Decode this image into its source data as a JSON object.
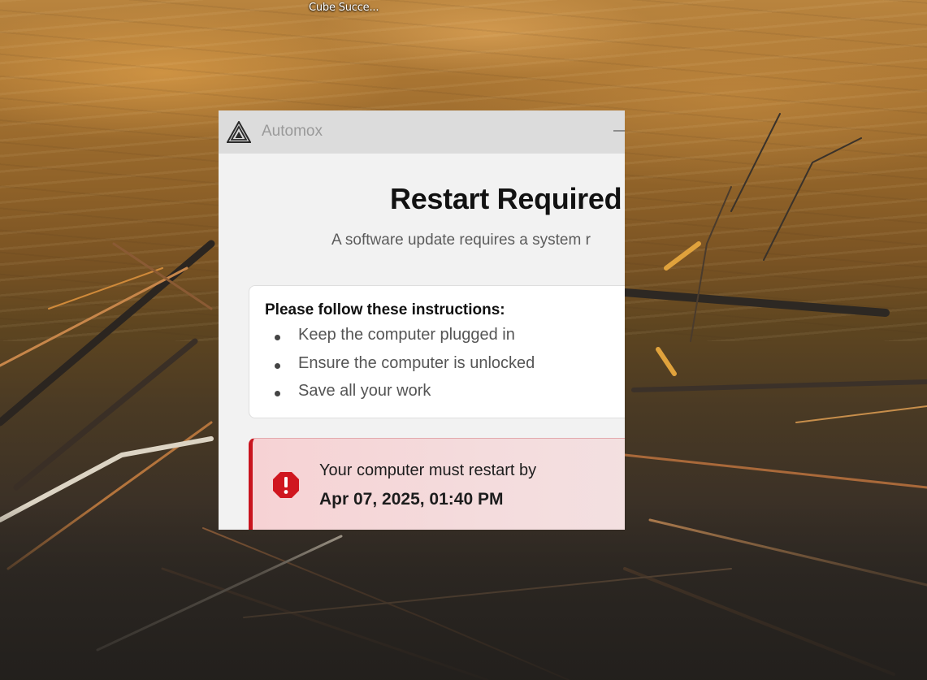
{
  "desktop": {
    "icon_label": "Cube Succe..."
  },
  "dialog": {
    "app_name": "Automox",
    "app_logo_icon": "automox-logo-icon",
    "minimize_icon": "minimize-icon",
    "title": "Restart Required",
    "subtitle": "A software update requires a system r",
    "instructions": {
      "heading": "Please follow these instructions:",
      "items": [
        {
          "text": "Keep the computer plugged in"
        },
        {
          "text": "Ensure the computer is unlocked"
        },
        {
          "text": "Save all your work"
        }
      ]
    },
    "deadline": {
      "icon": "alert-octagon-icon",
      "message": "Your computer must restart by",
      "datetime": "Apr 07, 2025, 01:40 PM"
    }
  },
  "colors": {
    "alert_accent": "#c9141e",
    "alert_background": "#f6d2d4",
    "titlebar_background": "#dcdcdc",
    "dialog_background": "#f2f2f2"
  }
}
